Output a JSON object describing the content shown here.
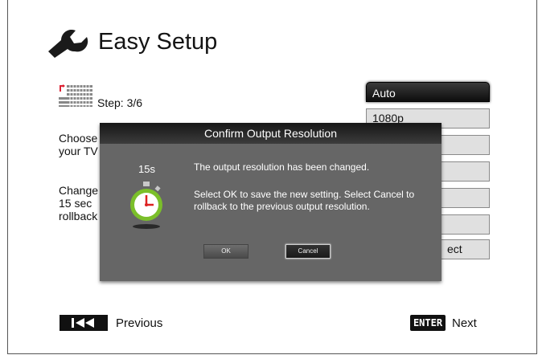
{
  "header": {
    "title": "Easy Setup",
    "icon": "wrench-icon"
  },
  "step": {
    "label": "Step: 3/6",
    "icon": "step-grid-icon"
  },
  "body": {
    "para1_line1": "Choose",
    "para1_line2": "your TV",
    "para2_line1": "Change",
    "para2_line2": "15 sec",
    "para2_line3": "rollback"
  },
  "options": [
    {
      "label": "Auto",
      "selected": true
    },
    {
      "label": "1080p",
      "selected": false
    },
    {
      "label": "",
      "selected": false
    },
    {
      "label": "",
      "selected": false
    },
    {
      "label": "",
      "selected": false
    },
    {
      "label": "",
      "selected": false
    },
    {
      "label": "ect",
      "selected": false
    }
  ],
  "dialog": {
    "title": "Confirm Output Resolution",
    "countdown": "15s",
    "icon": "stopwatch-icon",
    "message1": "The output resolution has been changed.",
    "message2": "Select OK to save the new setting. Select Cancel to rollback to the previous output resolution.",
    "ok_label": "OK",
    "cancel_label": "Cancel"
  },
  "footer": {
    "prev_label": "Previous",
    "prev_icon": "skip-previous-icon",
    "enter_key": "ENTER",
    "next_label": "Next"
  },
  "colors": {
    "dialog_bg": "#666666",
    "option_bg": "#e0e0e0",
    "selected_bg": "#111111"
  }
}
